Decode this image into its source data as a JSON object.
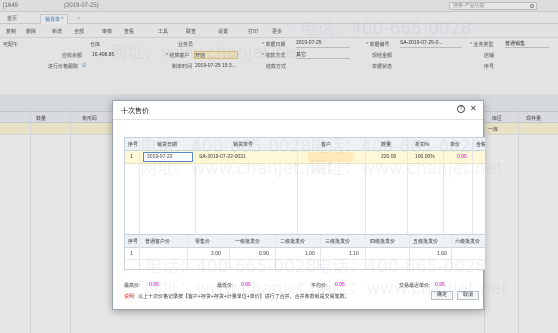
{
  "topbar": {
    "doc_code": "[1649",
    "doc_date": "(2019-07-25)",
    "search_placeholder": "搜索-产品功能"
  },
  "tabs": [
    {
      "label": "首页"
    },
    {
      "label": "销货单 *"
    }
  ],
  "toolbar": {
    "items": [
      "复制",
      "删除",
      "新增",
      "全部",
      "审核",
      "查看",
      "工具",
      "联查",
      "设置",
      "打印",
      "更多"
    ]
  },
  "form": {
    "f1_label": "可配午",
    "warehouse_label": "仓库",
    "available_balance_label": "应收余额",
    "available_balance_value": "16,408.85",
    "price_tracking_label": "进行价格跟踪",
    "salesman_label": "业务员",
    "customer_label": "* 结算客户",
    "customer_value": "开创",
    "created_label": "制单时间",
    "created_value": "2019-07-25 15:3...",
    "doc_date_label": "* 单据日期",
    "doc_date_value": "2019-07-25",
    "pay_method_label": "* 收款方式",
    "pay_method_value": "其它",
    "settle_label": "结款方式",
    "doc_no_label": "* 单据编号",
    "doc_no_value": "SA-2019-07-25-0...",
    "cash_label": "现结金额",
    "status_label": "单据状态",
    "biz_type_label": "* 业务类型",
    "biz_type_value": "普通销售",
    "store_label": "店铺",
    "seq_label": "序号"
  },
  "grid": {
    "headers": [
      "数量",
      "条形码",
      "库区",
      "现存量"
    ],
    "row_value": "一库"
  },
  "watermark": {
    "phone": "电话：400-665-0028",
    "site": "网址：www.chanjet.net"
  },
  "dialog": {
    "title": "十次售价",
    "help": "?",
    "close": "✕",
    "table1": {
      "headers": [
        "序号",
        "销货日期",
        "销货单号",
        "客户",
        "数量",
        "折扣%",
        "单价",
        "含税"
      ],
      "rows": [
        {
          "seq": "1",
          "date": "2019-07-22",
          "no": "SA-2019-07-22-0031",
          "customer": "",
          "qty": "220.00",
          "discount": "100.00%",
          "price": "0.95"
        }
      ]
    },
    "table2": {
      "headers": [
        "序号",
        "普通客户价",
        "零售价",
        "一级批发价",
        "二级批发价",
        "三级批发价",
        "四级批发价",
        "五级批发价",
        "六级批发价"
      ],
      "rows": [
        {
          "seq": "1",
          "normal": "",
          "retail": "2.00",
          "l1": "0.90",
          "l2": "1.00",
          "l3": "1.10",
          "l4": "",
          "l5": "1.60",
          "l6": ""
        }
      ]
    },
    "summary": {
      "max_label": "最高价:",
      "max_value": "0.95",
      "min_label": "最低价:",
      "min_value": "0.95",
      "avg_label": "平均价:",
      "avg_value": "0.95",
      "latest_label": "交易最近单价:",
      "latest_value": "0.95"
    },
    "note_label": "说明:",
    "note_text": "以上十次价格记录按【客户+存货+存货+计量单位+单价】进行了合并，合并条款就是交易笔数。",
    "confirm": "确定",
    "cancel": "取消"
  }
}
